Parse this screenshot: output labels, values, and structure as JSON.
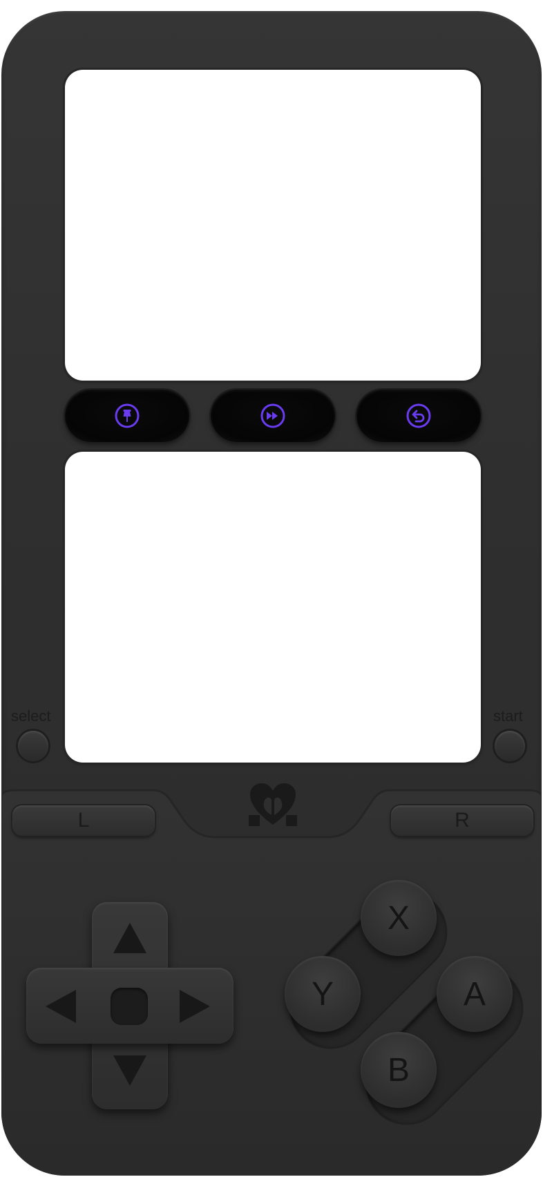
{
  "labels": {
    "select": "select",
    "start": "start",
    "l": "L",
    "r": "R",
    "x": "X",
    "y": "Y",
    "a": "A",
    "b": "B"
  },
  "toolbar": {
    "buttons": [
      {
        "icon": "pin-icon"
      },
      {
        "icon": "fast-forward-icon"
      },
      {
        "icon": "rewind-icon"
      }
    ],
    "accent": "#6a3cf0"
  },
  "colors": {
    "body": "#2f2f2f",
    "screen": "#ffffff"
  }
}
